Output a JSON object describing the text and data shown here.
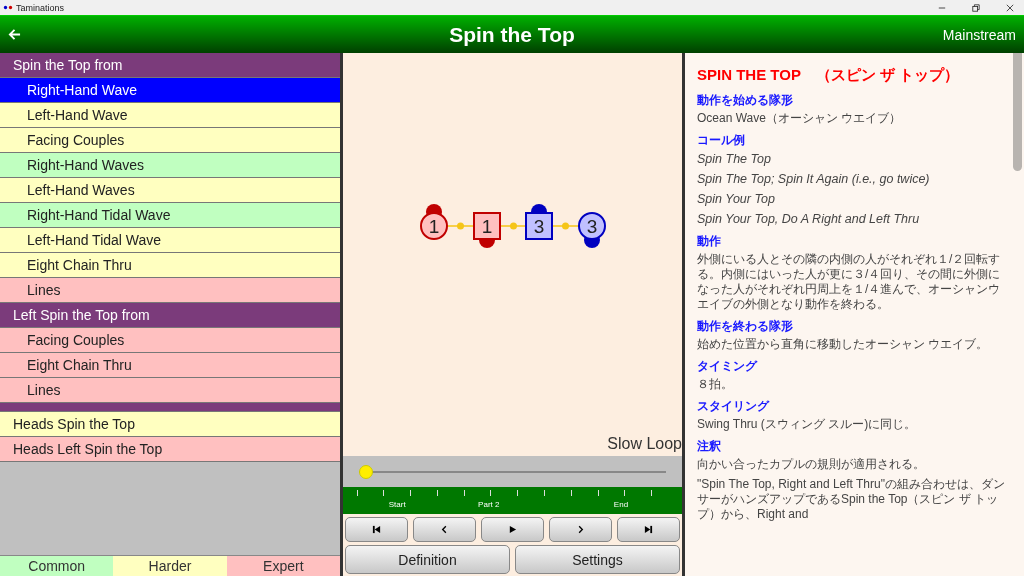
{
  "window": {
    "title": "Taminations"
  },
  "header": {
    "title": "Spin the Top",
    "level_label": "Mainstream"
  },
  "sidebar": {
    "items": [
      {
        "kind": "header",
        "label": "Spin the Top from"
      },
      {
        "kind": "item",
        "label": "Right-Hand Wave",
        "selected": true
      },
      {
        "kind": "item",
        "label": "Left-Hand Wave",
        "color": "#ffffc0",
        "selected": false
      },
      {
        "kind": "item",
        "label": "Facing Couples",
        "color": "#ffffc0",
        "selected": false
      },
      {
        "kind": "item",
        "label": "Right-Hand Waves",
        "color": "#c0ffc0",
        "selected": false
      },
      {
        "kind": "item",
        "label": "Left-Hand Waves",
        "color": "#ffffc0",
        "selected": false
      },
      {
        "kind": "item",
        "label": "Right-Hand Tidal Wave",
        "color": "#c0ffc0",
        "selected": false
      },
      {
        "kind": "item",
        "label": "Left-Hand Tidal Wave",
        "color": "#ffffc0",
        "selected": false
      },
      {
        "kind": "item",
        "label": "Eight Chain Thru",
        "color": "#ffffc0",
        "selected": false
      },
      {
        "kind": "item",
        "label": "Lines",
        "color": "#ffc0c0",
        "selected": false
      },
      {
        "kind": "header",
        "label": "Left Spin the Top from"
      },
      {
        "kind": "item",
        "label": "Facing Couples",
        "color": "#ffc0c0",
        "selected": false
      },
      {
        "kind": "item",
        "label": "Eight Chain Thru",
        "color": "#ffc0c0",
        "selected": false
      },
      {
        "kind": "item",
        "label": "Lines",
        "color": "#ffc0c0",
        "selected": false
      },
      {
        "kind": "separator"
      },
      {
        "kind": "item",
        "label": "Heads Spin the Top",
        "color": "#ffffc0",
        "selected": false
      },
      {
        "kind": "item",
        "label": "Heads Left Spin the Top",
        "color": "#ffc0c0",
        "selected": false
      }
    ],
    "legend": [
      {
        "label": "Common",
        "color": "#c0ffc0"
      },
      {
        "label": "Harder",
        "color": "#ffffc0"
      },
      {
        "label": "Expert",
        "color": "#ffc0c0"
      }
    ]
  },
  "animation": {
    "dancers": [
      {
        "number": "1",
        "kind": "circle",
        "color": "#c00000",
        "facing_up": true
      },
      {
        "number": "1",
        "kind": "square",
        "color": "#c00000",
        "facing_up": false
      },
      {
        "number": "3",
        "kind": "square",
        "color": "#0000c0",
        "facing_up": true
      },
      {
        "number": "3",
        "kind": "circle",
        "color": "#0000c0",
        "facing_up": false
      }
    ],
    "loop_label": "Slow Loop",
    "slider": {
      "level": 0
    },
    "tick_labels": [
      "Start",
      "Part 2",
      "End"
    ],
    "buttons": [
      "Definition",
      "Settings"
    ]
  },
  "definition": {
    "title": "SPIN THE TOP　（スピン ザ トップ）",
    "sections": [
      {
        "heading": "動作を始める隊形",
        "paragraphs": [
          {
            "text": "Ocean Wave（オーシャン ウエイブ）",
            "italic": false
          }
        ]
      },
      {
        "heading": "コール例",
        "paragraphs": [
          {
            "text": "Spin The Top",
            "italic": true
          },
          {
            "text": "Spin The Top; Spin It Again (i.e., go twice)",
            "italic": true
          },
          {
            "text": "Spin Your Top",
            "italic": true
          },
          {
            "text": "Spin Your Top, Do A Right and Left Thru",
            "italic": true
          }
        ]
      },
      {
        "heading": "動作",
        "paragraphs": [
          {
            "text": "外側にいる人とその隣の内側の人がそれぞれ１/２回転する。内側にはいった人が更に３/４回り、その間に外側になった人がそれぞれ円周上を１/４進んで、オーシャンウエイブの外側となり動作を終わる。",
            "italic": false
          }
        ]
      },
      {
        "heading": "動作を終わる隊形",
        "paragraphs": [
          {
            "text": "始めた位置から直角に移動したオーシャン ウエイブ。",
            "italic": false
          }
        ]
      },
      {
        "heading": "タイミング",
        "paragraphs": [
          {
            "text": "８拍。",
            "italic": false
          }
        ]
      },
      {
        "heading": "スタイリング",
        "paragraphs": [
          {
            "text": "Swing Thru (スウィング スルー)に同じ。",
            "italic": false
          }
        ]
      },
      {
        "heading": "注釈",
        "paragraphs": [
          {
            "text": "向かい合ったカプルの規則が適用される。",
            "italic": false
          },
          {
            "text": "\"Spin The Top, Right and Left Thru\"の組み合わせは、ダンサーがハンズアップであるSpin the Top（スピン ザ トップ）から、Right and",
            "italic": false
          }
        ]
      }
    ]
  }
}
